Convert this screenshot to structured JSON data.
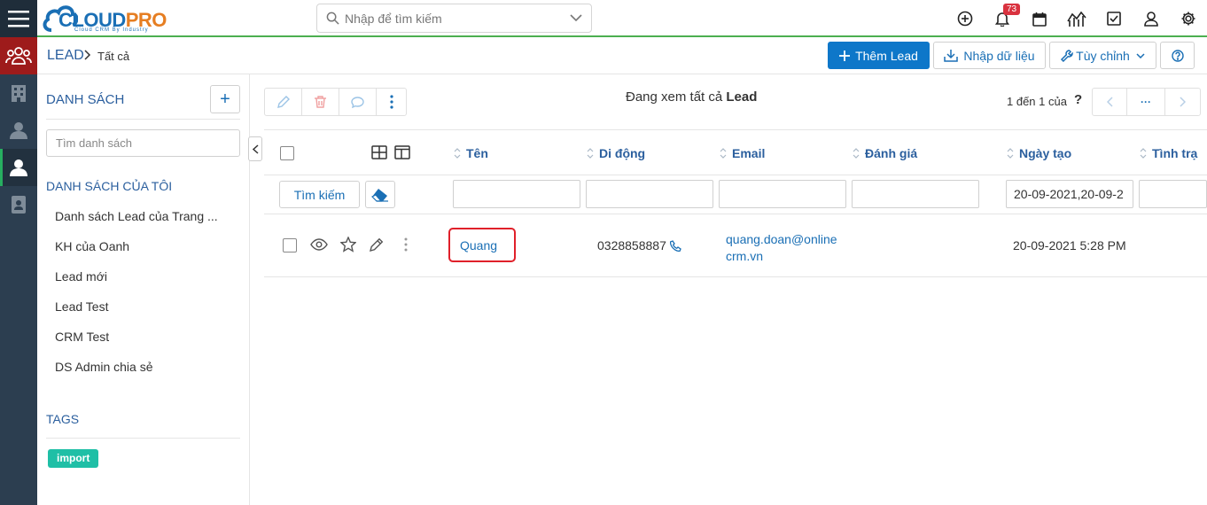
{
  "brand": {
    "logo_main": "CLOUD",
    "logo_accent": "PRO",
    "logo_sub": "Cloud CRM By Industry"
  },
  "header": {
    "search_placeholder": "Nhập để tìm kiếm",
    "notification_count": "73"
  },
  "breadcrumb": {
    "module": "LEAD",
    "current": "Tất cả"
  },
  "actions": {
    "add_label": "Thêm Lead",
    "import_label": "Nhập dữ liệu",
    "customize_label": "Tùy chỉnh"
  },
  "sidebar": {
    "title": "DANH SÁCH",
    "add_label": "+",
    "search_placeholder": "Tìm danh sách",
    "my_lists_title": "DANH SÁCH CỦA TÔI",
    "items": [
      {
        "label": "Danh sách Lead của Trang ..."
      },
      {
        "label": "KH của Oanh"
      },
      {
        "label": "Lead mới"
      },
      {
        "label": "Lead Test"
      },
      {
        "label": "CRM Test"
      },
      {
        "label": "DS Admin chia sẻ"
      }
    ],
    "tags_title": "TAGS",
    "tags": [
      {
        "label": "import",
        "color": "#1fbfa6"
      }
    ]
  },
  "main": {
    "viewing_prefix": "Đang xem tất cả",
    "viewing_module": "Lead",
    "page_count": "1 đến 1 của",
    "page_help": "?",
    "pager_more": "···",
    "columns": [
      {
        "label": "Tên"
      },
      {
        "label": "Di động"
      },
      {
        "label": "Email"
      },
      {
        "label": "Đánh giá"
      },
      {
        "label": "Ngày tạo"
      },
      {
        "label": "Tình trạ"
      }
    ],
    "filter_button": "Tìm kiếm",
    "filters": {
      "name": "",
      "mobile": "",
      "email": "",
      "rating": "",
      "created": "20-09-2021,20-09-2",
      "status": ""
    },
    "rows": [
      {
        "name": "Quang",
        "mobile": "0328858887",
        "email_line1": "quang.doan@online",
        "email_line2": "crm.vn",
        "rating": "",
        "created": "20-09-2021 5:28 PM"
      }
    ]
  },
  "colors": {
    "accent": "#0e77c9",
    "link": "#1a6fb5",
    "rail": "#2c3e50",
    "highlight": "#e0202a",
    "header_line": "#4caf50"
  }
}
